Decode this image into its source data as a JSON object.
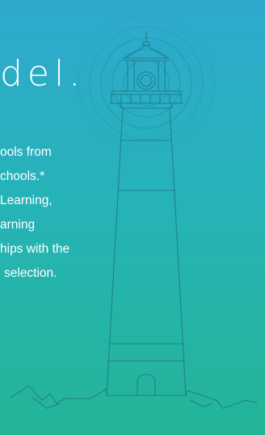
{
  "hero": {
    "heading": "del.",
    "lines": [
      "ools from",
      "chools.*",
      "Learning,",
      "arning",
      "hips with the",
      "selection."
    ]
  },
  "colors": {
    "gradient_top": "#2fa9cf",
    "gradient_bottom": "#23b596",
    "line_art": "#1f7f8f"
  },
  "icons": {
    "illustration": "lighthouse-illustration"
  }
}
